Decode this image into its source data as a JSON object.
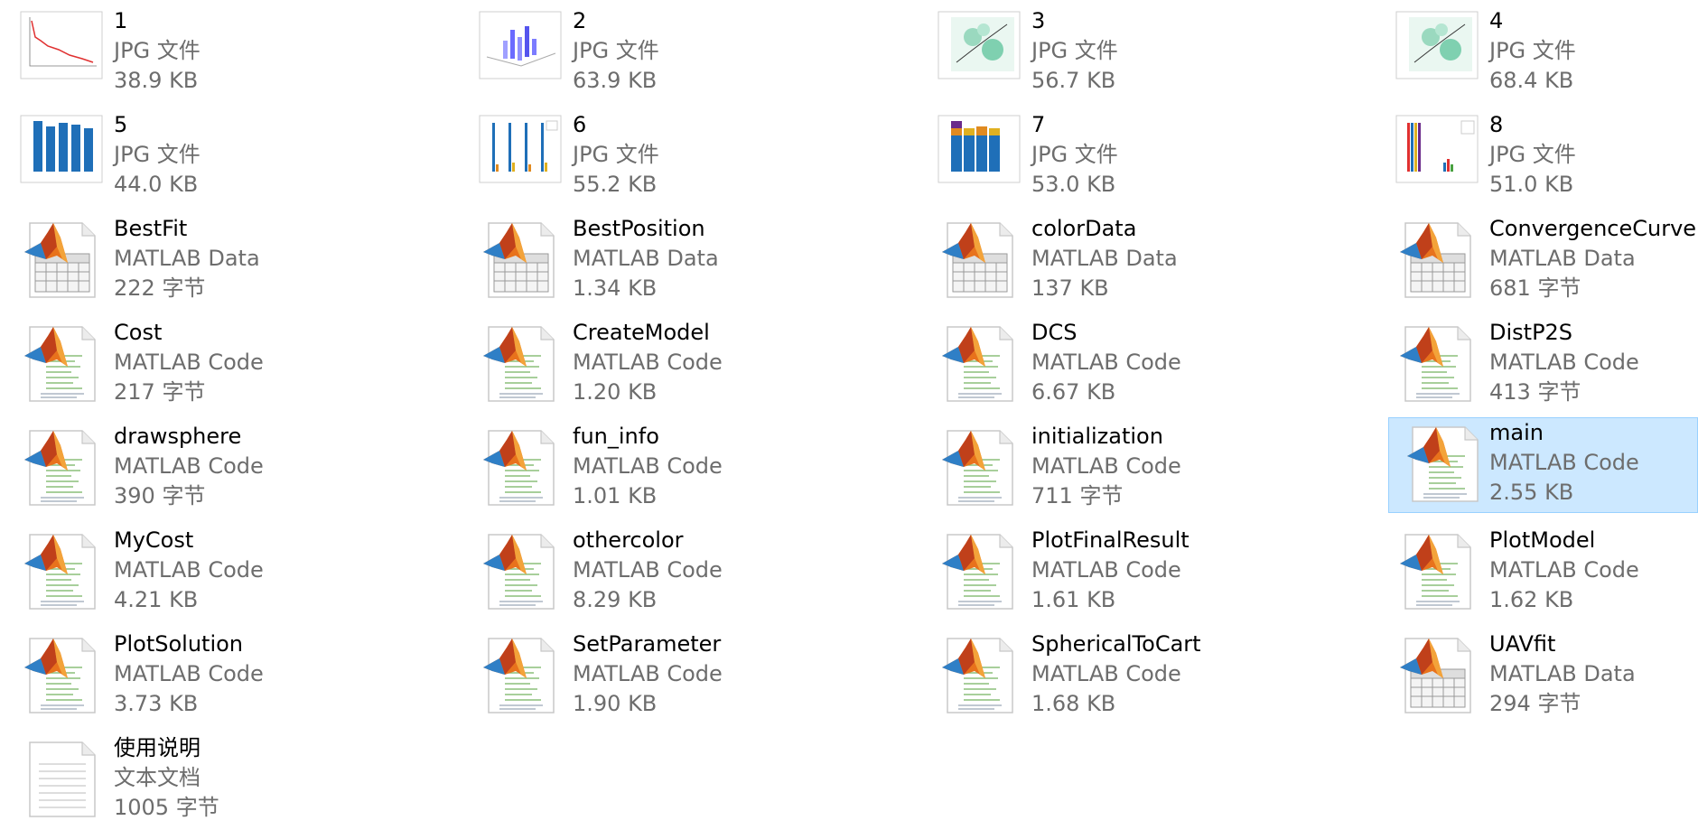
{
  "files": [
    {
      "name": "1",
      "type": "JPG 文件",
      "size": "38.9 KB",
      "icon": "image-line-chart-icon"
    },
    {
      "name": "2",
      "type": "JPG 文件",
      "size": "63.9 KB",
      "icon": "image-3d-bar-chart-icon"
    },
    {
      "name": "3",
      "type": "JPG 文件",
      "size": "56.7 KB",
      "icon": "image-heatmap-chart-icon"
    },
    {
      "name": "4",
      "type": "JPG 文件",
      "size": "68.4 KB",
      "icon": "image-heatmap-chart-icon"
    },
    {
      "name": "5",
      "type": "JPG 文件",
      "size": "44.0 KB",
      "icon": "image-bar-chart-icon"
    },
    {
      "name": "6",
      "type": "JPG 文件",
      "size": "55.2 KB",
      "icon": "image-grouped-bar-chart-icon"
    },
    {
      "name": "7",
      "type": "JPG 文件",
      "size": "53.0 KB",
      "icon": "image-stacked-bar-chart-icon"
    },
    {
      "name": "8",
      "type": "JPG 文件",
      "size": "51.0 KB",
      "icon": "image-multicolor-bar-chart-icon"
    },
    {
      "name": "BestFit",
      "type": "MATLAB Data",
      "size": "222 字节",
      "icon": "matlab-data-icon"
    },
    {
      "name": "BestPosition",
      "type": "MATLAB Data",
      "size": "1.34 KB",
      "icon": "matlab-data-icon"
    },
    {
      "name": "colorData",
      "type": "MATLAB Data",
      "size": "137 KB",
      "icon": "matlab-data-icon"
    },
    {
      "name": "ConvergenceCurve",
      "type": "MATLAB Data",
      "size": "681 字节",
      "icon": "matlab-data-icon"
    },
    {
      "name": "Cost",
      "type": "MATLAB Code",
      "size": "217 字节",
      "icon": "matlab-code-icon"
    },
    {
      "name": "CreateModel",
      "type": "MATLAB Code",
      "size": "1.20 KB",
      "icon": "matlab-code-icon"
    },
    {
      "name": "DCS",
      "type": "MATLAB Code",
      "size": "6.67 KB",
      "icon": "matlab-code-icon"
    },
    {
      "name": "DistP2S",
      "type": "MATLAB Code",
      "size": "413 字节",
      "icon": "matlab-code-icon"
    },
    {
      "name": "drawsphere",
      "type": "MATLAB Code",
      "size": "390 字节",
      "icon": "matlab-code-icon"
    },
    {
      "name": "fun_info",
      "type": "MATLAB Code",
      "size": "1.01 KB",
      "icon": "matlab-code-icon"
    },
    {
      "name": "initialization",
      "type": "MATLAB Code",
      "size": "711 字节",
      "icon": "matlab-code-icon"
    },
    {
      "name": "main",
      "type": "MATLAB Code",
      "size": "2.55 KB",
      "icon": "matlab-code-icon",
      "selected": true
    },
    {
      "name": "MyCost",
      "type": "MATLAB Code",
      "size": "4.21 KB",
      "icon": "matlab-code-icon"
    },
    {
      "name": "othercolor",
      "type": "MATLAB Code",
      "size": "8.29 KB",
      "icon": "matlab-code-icon"
    },
    {
      "name": "PlotFinalResult",
      "type": "MATLAB Code",
      "size": "1.61 KB",
      "icon": "matlab-code-icon"
    },
    {
      "name": "PlotModel",
      "type": "MATLAB Code",
      "size": "1.62 KB",
      "icon": "matlab-code-icon"
    },
    {
      "name": "PlotSolution",
      "type": "MATLAB Code",
      "size": "3.73 KB",
      "icon": "matlab-code-icon"
    },
    {
      "name": "SetParameter",
      "type": "MATLAB Code",
      "size": "1.90 KB",
      "icon": "matlab-code-icon"
    },
    {
      "name": "SphericalToCart",
      "type": "MATLAB Code",
      "size": "1.68 KB",
      "icon": "matlab-code-icon"
    },
    {
      "name": "UAVfit",
      "type": "MATLAB Data",
      "size": "294 字节",
      "icon": "matlab-data-icon"
    },
    {
      "name": "使用说明",
      "type": "文本文档",
      "size": "1005 字节",
      "icon": "text-document-icon"
    }
  ],
  "colors": {
    "selection_bg": "#cce8ff",
    "selection_border": "#99d1ff",
    "secondary_text": "#6d6d6d"
  }
}
